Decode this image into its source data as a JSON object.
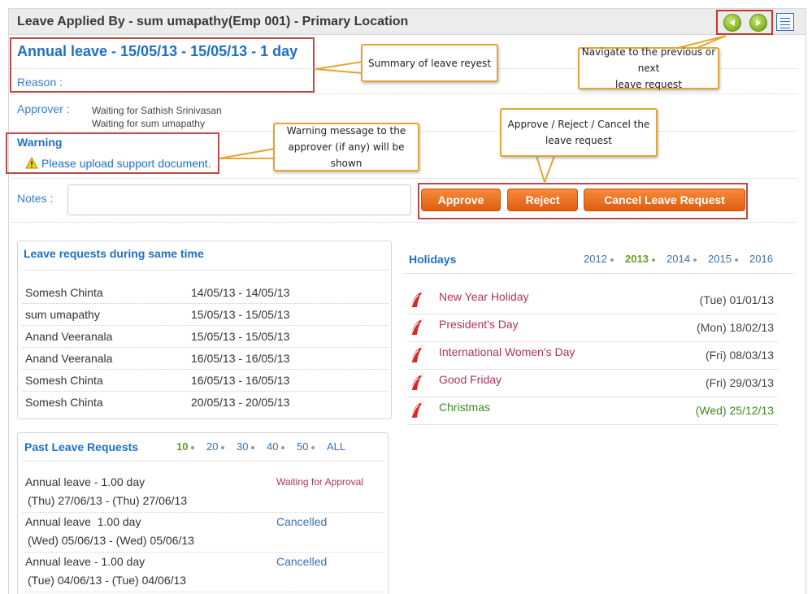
{
  "header": {
    "title": "Leave Applied By - sum umapathy(Emp 001) - Primary Location",
    "prev_icon": "arrow-left-icon",
    "next_icon": "arrow-right-icon",
    "list_icon": "list-view-icon"
  },
  "summary": {
    "title": "Annual leave - 15/05/13 - 15/05/13 - 1 day",
    "reason_label": "Reason :",
    "approver_label": "Approver :",
    "approvers": [
      "Waiting for Sathish Srinivasan",
      "Waiting for sum umapathy"
    ],
    "warning_label": "Warning",
    "warning_message": "Please upload support document.",
    "notes_label": "Notes :",
    "notes_value": ""
  },
  "actions": {
    "approve": "Approve",
    "reject": "Reject",
    "cancel": "Cancel Leave Request"
  },
  "callouts": {
    "summary": "Summary of leave reyest",
    "navigate_1": "Navigate to the previous or next",
    "navigate_2": "leave request",
    "warning_1": "Warning message to the",
    "warning_2": "approver (if any) will be shown",
    "actions_1": "Approve / Reject / Cancel the",
    "actions_2": "leave request"
  },
  "same_time": {
    "title": "Leave requests during same time",
    "rows": [
      {
        "name": "Somesh Chinta",
        "dates": "14/05/13 - 14/05/13"
      },
      {
        "name": "sum umapathy",
        "dates": "15/05/13 - 15/05/13"
      },
      {
        "name": "Anand Veeranala",
        "dates": "15/05/13 - 15/05/13"
      },
      {
        "name": "Anand Veeranala",
        "dates": "16/05/13 - 16/05/13"
      },
      {
        "name": "Somesh Chinta",
        "dates": "16/05/13 - 16/05/13"
      },
      {
        "name": "Somesh Chinta",
        "dates": "20/05/13 - 20/05/13"
      }
    ]
  },
  "holidays": {
    "title": "Holidays",
    "years": [
      "2012",
      "2013",
      "2014",
      "2015",
      "2016"
    ],
    "selected_year": "2013",
    "items": [
      {
        "name": "New Year Holiday",
        "date": "(Tue) 01/01/13"
      },
      {
        "name": "President's Day",
        "date": "(Mon) 18/02/13"
      },
      {
        "name": "International Women's Day",
        "date": "(Fri) 08/03/13"
      },
      {
        "name": "Good Friday",
        "date": "(Fri) 29/03/13"
      },
      {
        "name": "Christmas",
        "date": "(Wed) 25/12/13"
      }
    ]
  },
  "past": {
    "title": "Past Leave Requests",
    "page_sizes": [
      "10",
      "20",
      "30",
      "40",
      "50",
      "ALL"
    ],
    "selected_page_size": "10",
    "rows": [
      {
        "type": "Annual leave",
        "duration": " - 1.00 day",
        "dates": "(Thu) 27/06/13 - (Thu) 27/06/13",
        "status": "Waiting for Approval"
      },
      {
        "type": "Annual leave",
        "duration": "  1.00 day",
        "dates": "(Wed) 05/06/13 - (Wed) 05/06/13",
        "status": "Cancelled"
      },
      {
        "type": "Annual leave",
        "duration": " - 1.00 day",
        "dates": "(Tue) 04/06/13 - (Tue) 04/06/13",
        "status": "Cancelled"
      }
    ]
  }
}
